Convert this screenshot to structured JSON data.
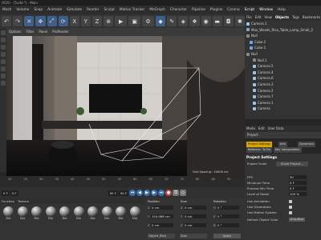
{
  "window": {
    "title": "(R20) - [5x4d *] - Main"
  },
  "menu": [
    "Mesh",
    "Volume",
    "Snap",
    "Animate",
    "Simulate",
    "Render",
    "Sculpt",
    "Motion Tracker",
    "MoGraph",
    "Character",
    "Pipeline",
    "Plugins",
    "Corona",
    "Script",
    "Window",
    "Help"
  ],
  "viewport": {
    "menu": [
      "Options",
      "Filter",
      "Panel",
      "ProRender"
    ],
    "grid_spacing": "Grid Spacing : 10000 cm"
  },
  "object_manager": {
    "tabs": [
      "File",
      "Edit",
      "View",
      "Objects",
      "Tags",
      "Bookmarks"
    ],
    "active_tab": "Objects",
    "objects": [
      {
        "name": "Camera.1",
        "type": "cam"
      },
      {
        "name": "Max_Woods_Risa_Table_Lamp_Small_2",
        "type": "obj"
      },
      {
        "name": "Null",
        "type": "null"
      },
      {
        "name": "Cube.2",
        "type": "cube"
      },
      {
        "name": "Cube.1",
        "type": "cube"
      },
      {
        "name": "Null",
        "type": "null"
      },
      {
        "name": "Null.1",
        "type": "null"
      },
      {
        "name": "Camera.5",
        "type": "cam"
      },
      {
        "name": "Camera.4",
        "type": "cam"
      },
      {
        "name": "Camera.6",
        "type": "cam"
      },
      {
        "name": "Camera.3",
        "type": "cam"
      },
      {
        "name": "Camera.2",
        "type": "cam"
      },
      {
        "name": "Camera.7",
        "type": "cam"
      },
      {
        "name": "Camera.1",
        "type": "cam"
      },
      {
        "name": "Camera",
        "type": "cam"
      }
    ]
  },
  "attributes": {
    "menu": [
      "Mode",
      "Edit",
      "User Data"
    ],
    "header": "Project",
    "tabs": [
      "Project Settings",
      "Info",
      "Dynamics",
      "Referencing",
      "To Do",
      "Key Interpolation"
    ],
    "active_tab": "Project Settings",
    "section_title": "Project Settings",
    "rows": [
      {
        "label": "Project Scale",
        "value": "1"
      },
      {
        "label": "FPS",
        "value": "30"
      },
      {
        "label": "Minimum Time",
        "value": "0 F"
      },
      {
        "label": "Preview Min Time",
        "value": "0 F"
      },
      {
        "label": "Level of Detail",
        "value": "100 %"
      },
      {
        "label": "Use Animation",
        "value": ""
      },
      {
        "label": "Use Generators",
        "value": ""
      },
      {
        "label": "Use Motion System",
        "value": ""
      },
      {
        "label": "Default Object Color",
        "value": "Gray-Blue"
      }
    ],
    "scale_button": "Scale Project...",
    "clear_button": "Gray-Blue"
  },
  "timeline": {
    "ticks": [
      "20",
      "25",
      "30",
      "35",
      "40",
      "45",
      "50",
      "55",
      "60",
      "65",
      "70",
      "75",
      "80",
      "85",
      "90"
    ],
    "current": "0 F",
    "start": "0 F",
    "end": "90 F",
    "end2": "90 F"
  },
  "material_manager": {
    "menu": [
      "Function",
      "Texture"
    ],
    "materials": [
      {
        "name": "Mat"
      },
      {
        "name": "Mat"
      },
      {
        "name": "Mat"
      },
      {
        "name": "Mat"
      },
      {
        "name": "Mat"
      },
      {
        "name": "Mat"
      },
      {
        "name": "Mat"
      },
      {
        "name": "Mat"
      },
      {
        "name": "Mat"
      },
      {
        "name": "Mat"
      }
    ]
  },
  "coordinates": {
    "headers": [
      "Position",
      "Size",
      "Rotation"
    ],
    "position": [
      "0 cm",
      "154.086 cm",
      "0 cm"
    ],
    "size": [
      "0 cm",
      "0 cm",
      "0 cm"
    ],
    "rotation": [
      "0 °",
      "0 °",
      "0 °"
    ],
    "axes_pos": [
      "X",
      "Y",
      "Z"
    ],
    "axes_rot": [
      "H",
      "P",
      "B"
    ],
    "mode": "Object (Rel)",
    "size_mode": "Size",
    "apply": "Apply"
  }
}
